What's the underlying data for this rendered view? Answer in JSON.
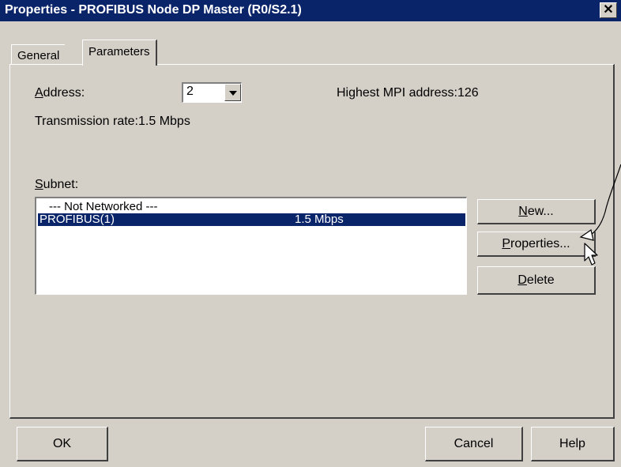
{
  "window": {
    "title": "Properties - PROFIBUS Node  DP Master (R0/S2.1)",
    "close_glyph": "✕"
  },
  "tabs": [
    {
      "label": "General",
      "active": false
    },
    {
      "label": "Parameters",
      "active": true
    }
  ],
  "address": {
    "label_mnemonic": "A",
    "label_rest": "ddress:",
    "value": "2",
    "highest_mpi_label": "Highest MPI address:126"
  },
  "transmission_rate": "Transmission rate:1.5 Mbps",
  "subnet": {
    "label_mnemonic": "S",
    "label_rest": "ubnet:",
    "rows": [
      {
        "name": "--- Not Networked ---",
        "rate": "",
        "selected": false
      },
      {
        "name": "PROFIBUS(1)",
        "rate": "1.5 Mbps",
        "selected": true
      }
    ],
    "buttons": {
      "new": {
        "mnemonic": "N",
        "rest": "ew..."
      },
      "properties": {
        "mnemonic": "P",
        "rest": "roperties..."
      },
      "delete": {
        "mnemonic": "D",
        "rest": "elete"
      }
    }
  },
  "footer": {
    "ok": "OK",
    "cancel": "Cancel",
    "help": "Help"
  },
  "colors": {
    "face": "#d4d0c8",
    "titlebar": "#0a246a",
    "selection": "#0a246a"
  },
  "icons": {
    "close": "close-icon",
    "dropdown": "chevron-down-icon",
    "cursor": "mouse-cursor-icon",
    "annotation": "callout-arrow-icon"
  }
}
